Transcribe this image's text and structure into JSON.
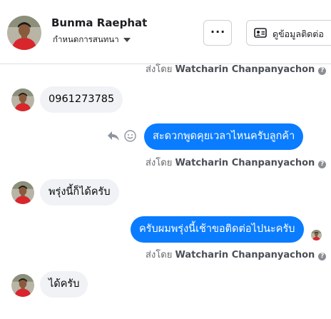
{
  "header": {
    "name": "Bunma Raephat",
    "subtitle": "กำหนดการสนทนา",
    "more_label": "···",
    "contact_label": "ดูข้อมูลติดต่อ"
  },
  "sender_prefix": "ส่งโดย",
  "sender_name": "Watcharin Chanpanyachon",
  "help_glyph": "?",
  "messages": [
    {
      "direction": "incoming",
      "text": "0961273785"
    },
    {
      "direction": "outgoing",
      "text": "สะดวกพูดคุยเวลาไหนครับลูกค้า"
    },
    {
      "direction": "incoming",
      "text": "พรุ่งนี้ก็ได้ครับ"
    },
    {
      "direction": "outgoing",
      "text": "ครับผมพรุ่งนี้เช้าขอติดต่อไปนะครับ"
    },
    {
      "direction": "incoming",
      "text": "ได้ครับ"
    }
  ],
  "colors": {
    "outgoing_bubble": "#0a7cff",
    "incoming_bubble": "#f0f2f5",
    "secondary_text": "#65676b"
  },
  "icons": [
    "person-avatar",
    "more-dots-icon",
    "contact-card-icon",
    "caret-down-icon",
    "reply-icon",
    "smiley-icon",
    "help-icon",
    "seen-avatar"
  ]
}
